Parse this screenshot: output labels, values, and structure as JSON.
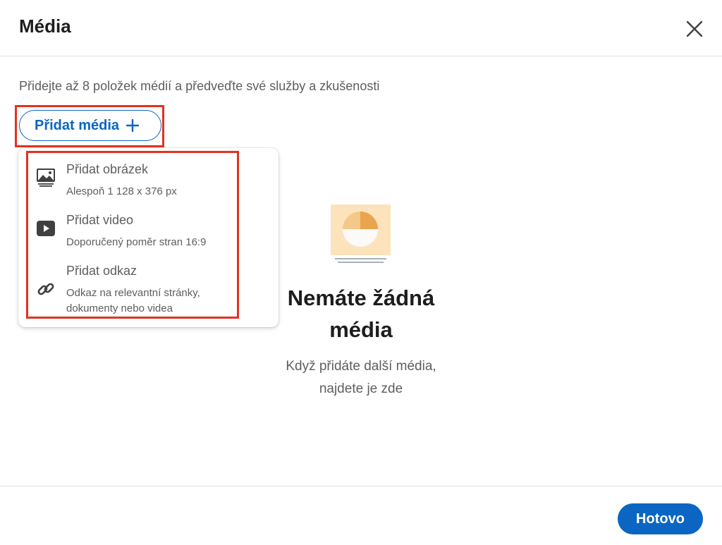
{
  "header": {
    "title": "Média",
    "close_icon": "close-icon"
  },
  "description": "Přidejte až 8 položek médií a předveďte své služby a zkušenosti",
  "add_media_button": {
    "label": "Přidat média",
    "icon": "plus-icon"
  },
  "menu": {
    "items": [
      {
        "title": "Přidat obrázek",
        "subtitle_lines": [
          "Alespoň 1 128 x 376 px"
        ],
        "icon": "image-icon"
      },
      {
        "title": "Přidat video",
        "subtitle_lines": [
          "Doporučený poměr stran 16:9"
        ],
        "icon": "video-play-icon"
      },
      {
        "title": "Přidat odkaz",
        "subtitle_lines": [
          "Odkaz na relevantní stránky,",
          "dokumenty nebo videa"
        ],
        "icon": "link-icon"
      }
    ]
  },
  "empty_state": {
    "title_lines": [
      "Nemáte žádná",
      "média"
    ],
    "subtitle_lines": [
      "Když přidáte další média,",
      "najdete je zde"
    ],
    "illustration": "empty-media-illustration"
  },
  "footer": {
    "done_label": "Hotovo"
  },
  "colors": {
    "accent": "#0a66c2",
    "highlight": "#e3321f",
    "text": "#1d1d1d",
    "muted": "#5e5e5e",
    "illustration_bg": "#fde3bb",
    "illustration_orange": "#efb15e"
  }
}
